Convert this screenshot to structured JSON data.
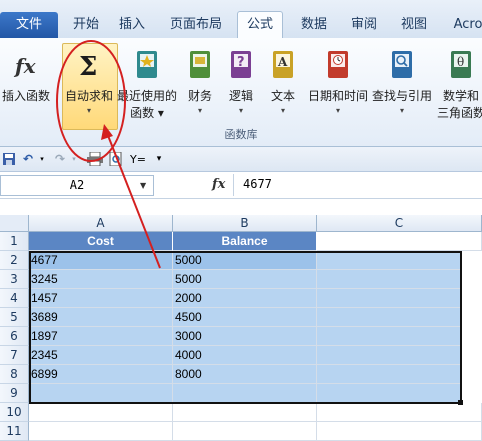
{
  "tabs": [
    {
      "label": "文件",
      "kind": "file"
    },
    {
      "label": "开始"
    },
    {
      "label": "插入"
    },
    {
      "label": "页面布局"
    },
    {
      "label": "公式",
      "active": true
    },
    {
      "label": "数据"
    },
    {
      "label": "审阅"
    },
    {
      "label": "视图"
    },
    {
      "label": "Acro"
    }
  ],
  "ribbon": {
    "buttons": [
      {
        "label": "插入函数",
        "icon": "fx-icon"
      },
      {
        "label": "自动求和",
        "label2": "▾",
        "icon": "sigma-icon",
        "highlighted": true
      },
      {
        "label": "最近使用的",
        "label2": "函数 ▾",
        "icon": "book-star-icon"
      },
      {
        "label": "财务",
        "label2": "▾",
        "icon": "book-finance-icon"
      },
      {
        "label": "逻辑",
        "label2": "▾",
        "icon": "book-question-icon"
      },
      {
        "label": "文本",
        "label2": "▾",
        "icon": "book-text-icon"
      },
      {
        "label": "日期和时间",
        "label2": "▾",
        "icon": "book-clock-icon"
      },
      {
        "label": "查找与引用",
        "label2": "▾",
        "icon": "book-search-icon"
      },
      {
        "label": "数学和",
        "label2": "三角函数",
        "icon": "book-theta-icon"
      }
    ],
    "group_label": "函数库"
  },
  "formula_bar": {
    "name_box": "A2",
    "fx_label": "fx",
    "value": "4677"
  },
  "grid": {
    "columns": [
      "A",
      "B",
      "C"
    ],
    "rows": [
      "1",
      "2",
      "3",
      "4",
      "5",
      "6",
      "7",
      "8",
      "9",
      "10",
      "11"
    ],
    "header": [
      "Cost",
      "Balance"
    ],
    "data": [
      [
        "4677",
        "5000"
      ],
      [
        "3245",
        "5000"
      ],
      [
        "1457",
        "2000"
      ],
      [
        "3689",
        "4500"
      ],
      [
        "1897",
        "3000"
      ],
      [
        "2345",
        "4000"
      ],
      [
        "6899",
        "8000"
      ]
    ]
  },
  "colors": {
    "header_fill": "#5b86c4",
    "selection_fill": "#b7d4f1",
    "annotation": "#d42020"
  }
}
